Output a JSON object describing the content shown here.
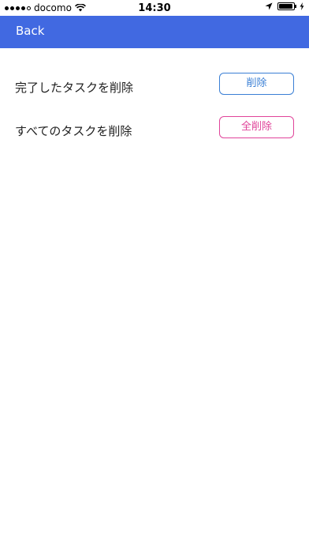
{
  "status_bar": {
    "carrier": "docomo",
    "time": "14:30",
    "battery_level": 0.95,
    "signal_bars_filled": 4,
    "signal_bars_total": 5
  },
  "nav": {
    "back_label": "Back"
  },
  "rows": [
    {
      "label": "完了したタスクを削除",
      "button_label": "削除",
      "button_color": "#3a7fd5"
    },
    {
      "label": "すべてのタスクを削除",
      "button_label": "全削除",
      "button_color": "#e0449a"
    }
  ],
  "colors": {
    "nav_background": "#4169e1"
  }
}
